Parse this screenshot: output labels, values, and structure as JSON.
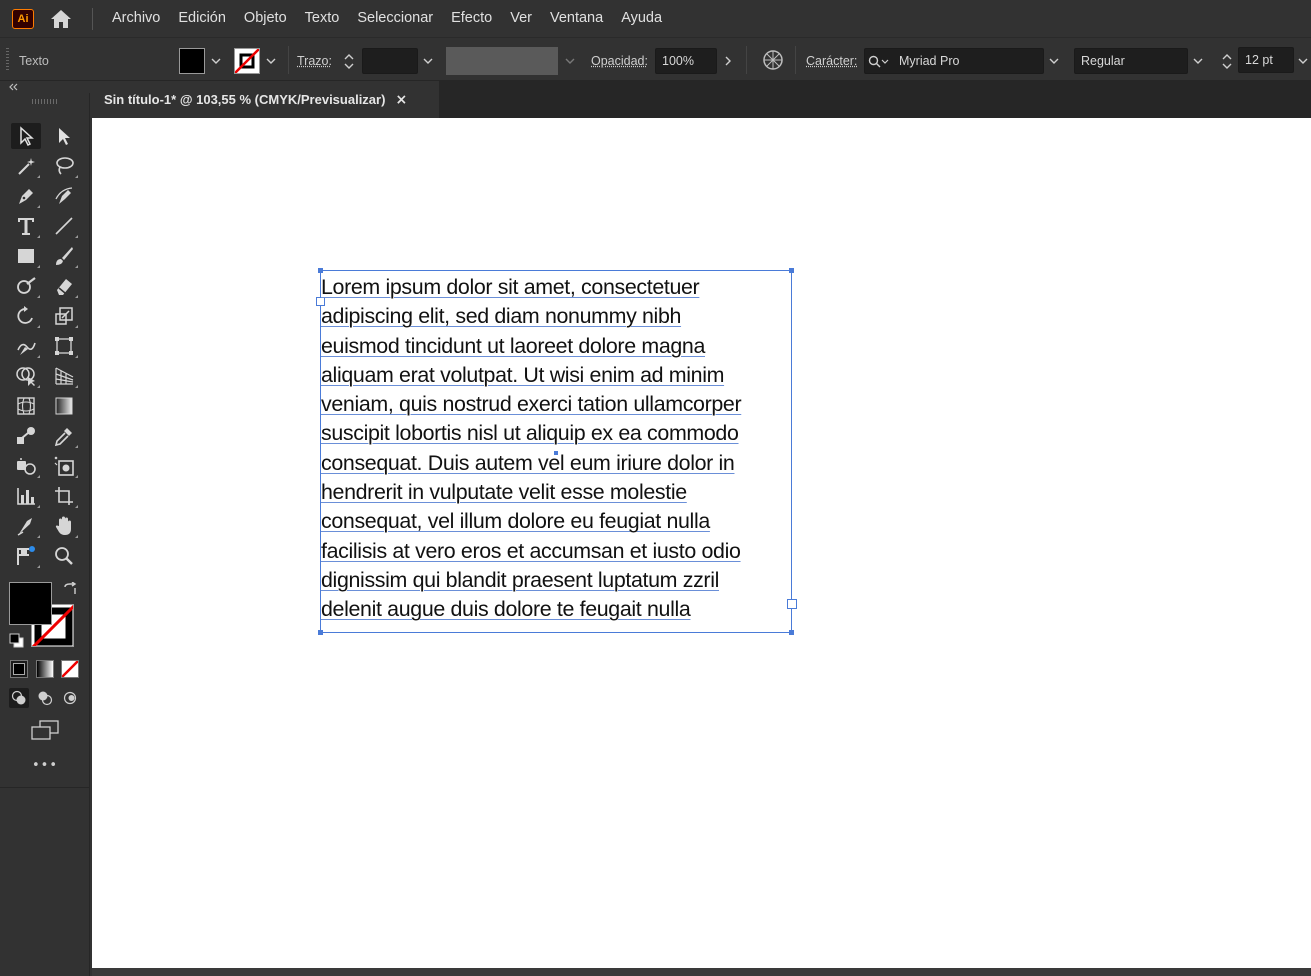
{
  "app": {
    "logo_text": "Ai"
  },
  "menu": [
    "Archivo",
    "Edición",
    "Objeto",
    "Texto",
    "Seleccionar",
    "Efecto",
    "Ver",
    "Ventana",
    "Ayuda"
  ],
  "controlbar": {
    "selection_label": "Texto",
    "stroke_label": "Trazo:",
    "opacity_label": "Opacidad:",
    "opacity_value": "100%",
    "character_label": "Carácter:",
    "font_family": "Myriad Pro",
    "font_style": "Regular",
    "font_size": "12 pt",
    "fill_color": "#000000"
  },
  "document": {
    "tab_title": "Sin título-1* @ 103,55 % (CMYK/Previsualizar)",
    "tab_close": "×"
  },
  "text_frame": {
    "lines": [
      "Lorem ipsum dolor sit amet, consectetuer",
      "adipiscing elit, sed diam nonummy nibh",
      "euismod tincidunt ut laoreet dolore magna",
      "aliquam erat volutpat. Ut wisi enim ad minim",
      "veniam, quis nostrud exerci tation ullamcorper",
      "suscipit lobortis nisl ut aliquip ex ea commodo",
      "consequat. Duis autem vel eum iriure dolor in",
      "hendrerit in vulputate velit esse molestie",
      "consequat, vel illum dolore eu feugiat nulla",
      "facilisis at vero eros et accumsan et iusto odio",
      "dignissim qui blandit praesent luptatum zzril",
      "delenit augue duis dolore te feugait nulla"
    ]
  },
  "toolbar": {
    "more_label": "•••",
    "tools": [
      "selection-tool",
      "direct-selection-tool",
      "magic-wand-tool",
      "lasso-tool",
      "pen-tool",
      "curvature-tool",
      "type-tool",
      "line-segment-tool",
      "rectangle-tool",
      "paintbrush-tool",
      "shaper-tool",
      "eraser-tool",
      "rotate-tool",
      "scale-tool",
      "warp-tool",
      "free-transform-tool",
      "shape-builder-tool",
      "perspective-grid-tool",
      "mesh-tool",
      "gradient-tool",
      "blend-tool",
      "eyedropper-tool",
      "symbol-sprayer-tool",
      "symbol-tool",
      "column-graph-tool",
      "artboard-tool",
      "slice-tool",
      "hand-tool",
      "puppet-warp-tool",
      "zoom-tool"
    ]
  },
  "colors": {
    "accent": "#4a7bd8",
    "canvas": "#ffffff",
    "ui_bg": "#323232"
  }
}
